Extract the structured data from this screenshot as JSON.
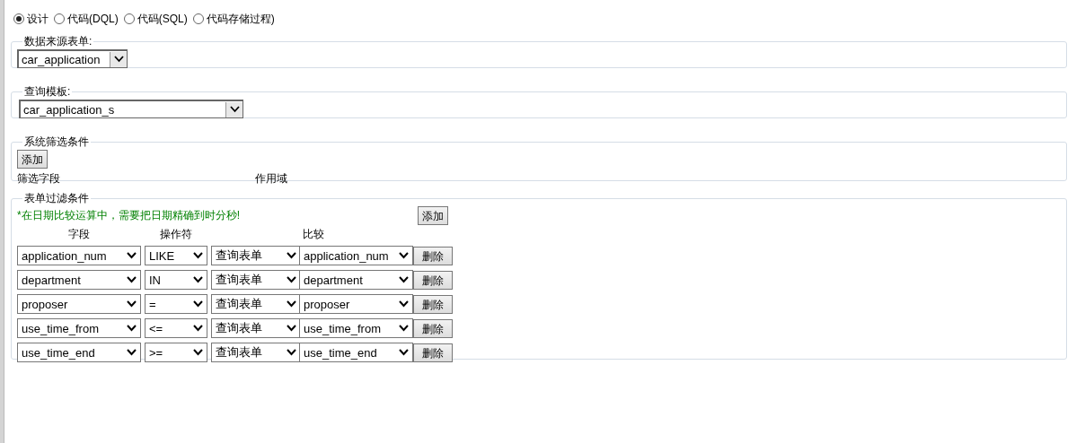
{
  "mode_options": [
    {
      "label": "设计",
      "selected": true
    },
    {
      "label": "代码(DQL)",
      "selected": false
    },
    {
      "label": "代码(SQL)",
      "selected": false
    },
    {
      "label": "代码存储过程)",
      "selected": false
    }
  ],
  "data_source": {
    "legend": "数据来源表单:",
    "value": "car_application"
  },
  "query_template": {
    "legend": "查询模板:",
    "value": "car_application_s"
  },
  "system_filter": {
    "legend": "系统筛选条件",
    "add_button": "添加",
    "columns": [
      "筛选字段",
      "作用域"
    ]
  },
  "form_filter": {
    "legend": "表单过滤条件",
    "note": "*在日期比较运算中，需要把日期精确到时分秒!",
    "add_button": "添加",
    "columns": [
      "字段",
      "操作符",
      "比较"
    ],
    "rows": [
      {
        "field": "application_num",
        "operator": "LIKE",
        "source": "查询表单",
        "compare": "application_num",
        "delete_button": "删除"
      },
      {
        "field": "department",
        "operator": "IN",
        "source": "查询表单",
        "compare": "department",
        "delete_button": "删除"
      },
      {
        "field": "proposer",
        "operator": "=",
        "source": "查询表单",
        "compare": "proposer",
        "delete_button": "删除"
      },
      {
        "field": "use_time_from",
        "operator": "<=",
        "source": "查询表单",
        "compare": "use_time_from",
        "delete_button": "删除"
      },
      {
        "field": "use_time_end",
        "operator": ">=",
        "source": "查询表单",
        "compare": "use_time_end",
        "delete_button": "删除"
      }
    ]
  }
}
